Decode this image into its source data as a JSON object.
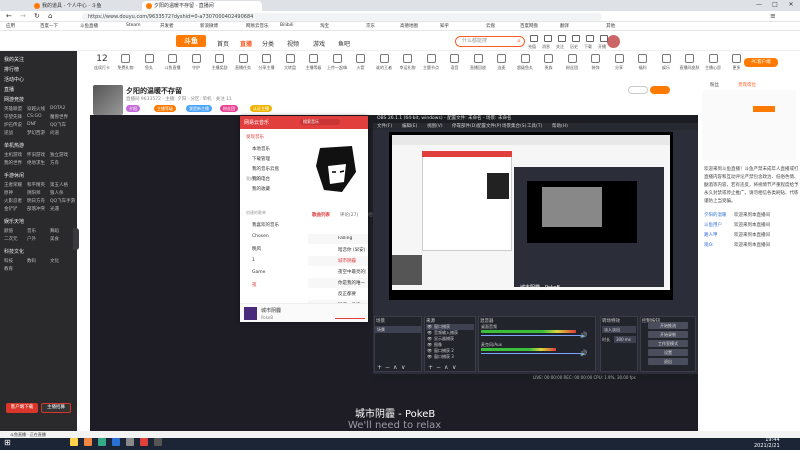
{
  "browser": {
    "tabs": [
      {
        "label": "我的道具 · 个人中心 · 斗鱼",
        "active": false
      },
      {
        "label": "夕阳的温暖不存留 · 直播间",
        "active": true
      }
    ],
    "url": "https://www.douyu.com/9633572?dyshid=0-a7307000402490684",
    "bookmarks": [
      "应用",
      "百度一下",
      "斗鱼直播",
      "Steam",
      "开发者",
      "新浪微博",
      "网易云音乐",
      "Bilibili",
      "淘宝",
      "京东",
      "高德地图",
      "知乎",
      "云盘",
      "百度网盘",
      "翻译",
      "其他"
    ]
  },
  "site": {
    "logo": "斗鱼",
    "nav": [
      {
        "label": "首页",
        "on": false
      },
      {
        "label": "直播",
        "on": true
      },
      {
        "label": "分类",
        "on": false
      },
      {
        "label": "视频",
        "on": false
      },
      {
        "label": "游戏",
        "on": false
      },
      {
        "label": "鱼吧",
        "on": false
      }
    ],
    "search_placeholder": "什么都能搜",
    "top_icons": [
      "充值",
      "消息",
      "关注",
      "历史",
      "下载",
      "开播"
    ]
  },
  "categories": [
    {
      "num": "12",
      "label": "连续打卡"
    },
    {
      "label": "免费礼物"
    },
    {
      "label": "鱼丸"
    },
    {
      "label": "斗鱼直播"
    },
    {
      "label": "守护"
    },
    {
      "label": "主播奖励"
    },
    {
      "label": "直播任务"
    },
    {
      "label": "分享主播"
    },
    {
      "label": "大转盘"
    },
    {
      "label": "主播等级"
    },
    {
      "label": "上传一起嗨"
    },
    {
      "label": "火箭"
    },
    {
      "label": "谁的王者"
    },
    {
      "label": "幸运礼物"
    },
    {
      "label": "主题节点"
    },
    {
      "label": "语音"
    },
    {
      "label": "直播回放"
    },
    {
      "label": "连麦"
    },
    {
      "label": "超级鱼丸"
    },
    {
      "label": "贵族"
    },
    {
      "label": "粉丝团"
    },
    {
      "label": "装饰"
    },
    {
      "label": "分享"
    },
    {
      "label": "福利"
    },
    {
      "label": "娱乐"
    },
    {
      "label": "直播间皮肤"
    },
    {
      "label": "主播心愿"
    },
    {
      "label": "更多"
    }
  ],
  "pc_button": "PC客户端",
  "room": {
    "title": "夕阳的温暖不存留",
    "meta": "直播间 9633572 · 主播: 夕阳 · 分区: 单机 · 关注 11",
    "pills": [
      "夕阳",
      "主播等级",
      "我是新主播",
      "粉丝团",
      "认证主播"
    ]
  },
  "sidebar": {
    "groups": [
      {
        "title": "我的关注",
        "items": []
      },
      {
        "title": "排行榜",
        "items": []
      },
      {
        "title": "活动中心",
        "items": []
      },
      {
        "title": "直播",
        "items": []
      },
      {
        "title": "网游竞技",
        "items": [
          "英雄联盟",
          "穿越火线",
          "DOTA2",
          "守望先锋",
          "CS:GO",
          "魔兽世界",
          "炉石传说",
          "DNF",
          "QQ飞车",
          "逆战",
          "梦幻西游",
          "问道"
        ]
      },
      {
        "title": "单机热游",
        "items": [
          "主机游戏",
          "怀旧游戏",
          "独立游戏",
          "我的世界",
          "绝地求生",
          "方舟"
        ]
      },
      {
        "title": "手游休闲",
        "items": [
          "王者荣耀",
          "和平精英",
          "第五人格",
          "原神",
          "阴阳师",
          "狼人杀",
          "火影忍者",
          "明日方舟",
          "QQ飞车手游",
          "金铲铲",
          "部落冲突",
          "光遇"
        ]
      },
      {
        "title": "娱乐天地",
        "items": [
          "颜值",
          "音乐",
          "舞蹈",
          "二次元",
          "户外",
          "美食"
        ]
      },
      {
        "title": "科技文化",
        "items": [
          "科技",
          "数码",
          "文化",
          "教育"
        ]
      }
    ],
    "bottom_left": "客户端下载",
    "bottom_right": "主播招募"
  },
  "netease": {
    "app_name": "网易云音乐",
    "search": "搜索音乐",
    "menu": [
      "发现音乐",
      "博客",
      "视频",
      "关注",
      "私人FM",
      "直播"
    ],
    "section_mine": "我的音乐",
    "mine_items": [
      "本地音乐",
      "下载管理",
      "我的音乐云盘",
      "我的电台",
      "我的收藏"
    ],
    "section_playlists": "创建的歌单",
    "playlists": [
      "我喜欢的音乐",
      "Chosen",
      "晚风",
      "1",
      "Game",
      "夜"
    ],
    "tabs": [
      "歌曲列表",
      "评论(27)",
      "相似歌曲"
    ],
    "tracks": [
      "Falling",
      "暗恋你 (早安)",
      "城市阴霾",
      "夜空中最亮的星",
      "你是我的唯一",
      "反正都要",
      "听说一件事"
    ],
    "now_playing": "城市阴霾",
    "now_artist": "PokeB"
  },
  "obs": {
    "title": "OBS 26.1.1 (64-bit, windows) - 配置文件: 未命名 - 场景: 未命名",
    "menu": [
      "文件(F)",
      "编辑(E)",
      "视图(V)",
      "停靠部件(D)",
      "配置文件(P)",
      "场景集合(S)",
      "工具(T)",
      "帮助(H)"
    ],
    "preview_label": "城市阴霾 - PokeB",
    "panes": [
      "场景",
      "来源",
      "混音器",
      "转场特效",
      "控制按钮"
    ],
    "scenes": [
      "场景"
    ],
    "sources": [
      "窗口捕获",
      "音频输入捕获",
      "显示器捕获",
      "图像",
      "窗口捕获 2",
      "窗口捕获 3"
    ],
    "mixer": [
      "桌面音频",
      "麦克风/Aux"
    ],
    "transition": "淡入淡出",
    "duration_label": "时长",
    "duration": "300 ms",
    "controls": [
      "开始推流",
      "开始录制",
      "工作室模式",
      "设置",
      "退出"
    ],
    "status": "LIVE: 00:00:00   REC: 00:00:00   CPU: 1.9%, 30.00 fps"
  },
  "caption": {
    "line1": "城市阴霾 - PokeB",
    "line2": "We'll need to relax"
  },
  "right_panel": {
    "tabs": [
      "粉丝",
      "贵宾席位"
    ],
    "chat": [
      "欢迎来到斗鱼直播！斗鱼严禁未成年人直播或打赏，",
      "直播内容和互动评论严禁包含政治、低俗色情、吸烟",
      "酗酒等内容，若有违反，将视情节严重程度给予禁播、",
      "永久封禁或停止推广。请勿相信各类刷钻、代练广告，",
      "谨防上当受骗。"
    ],
    "links": [
      {
        "name": "夕阳的温暖",
        "text": "欢迎来到本直播间"
      },
      {
        "name": "斗鱼用户",
        "text": "欢迎来到本直播间"
      },
      {
        "name": "路人甲",
        "text": "欢迎来到本直播间"
      },
      {
        "name": "观众",
        "text": "欢迎来到本直播间"
      }
    ]
  },
  "taskbar": {
    "notify": "斗鱼直播 · 正在直播",
    "time": "19:44",
    "date": "2021/2/21"
  },
  "colors": {
    "accent": "#ff5d23",
    "brand": "#ff7a00",
    "netease_red": "#e13e3e",
    "obs_bg": "#2b2e38"
  }
}
